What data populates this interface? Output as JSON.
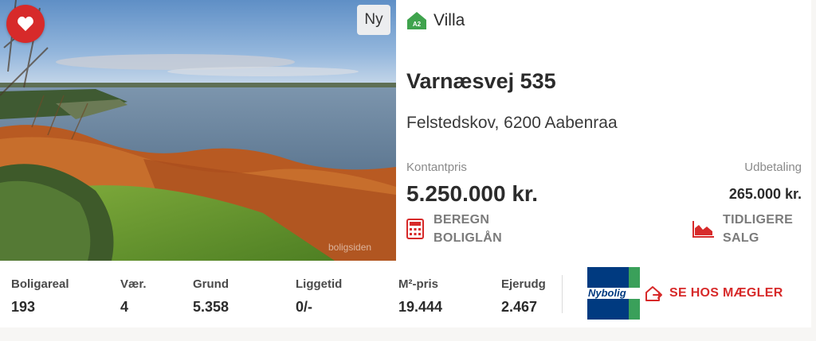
{
  "listing": {
    "badge_new": "Ny",
    "energy_label": "A2",
    "property_type": "Villa",
    "address": "Varnæsvej 535",
    "city": "Felstedskov, 6200 Aabenraa",
    "watermark": "boligsiden",
    "favorite_icon": "heart-icon"
  },
  "price": {
    "label": "Kontantpris",
    "value": "5.250.000 kr."
  },
  "down_payment": {
    "label": "Udbetaling",
    "value": "265.000 kr."
  },
  "actions": {
    "calculate_line1": "BEREGN",
    "calculate_line2": "BOLIGLÅN",
    "previous_sales_line1": "TIDLIGERE",
    "previous_sales_line2": "SALG"
  },
  "stats": [
    {
      "label": "Boligareal",
      "value": "193"
    },
    {
      "label": "Vær.",
      "value": "4"
    },
    {
      "label": "Grund",
      "value": "5.358"
    },
    {
      "label": "Liggetid",
      "value": "0/-"
    },
    {
      "label": "M²-pris",
      "value": "19.444"
    },
    {
      "label": "Ejerudg",
      "value": "2.467"
    }
  ],
  "agent": {
    "logo_text": "Nybolig",
    "cta": "SE HOS MÆGLER"
  },
  "colors": {
    "accent_red": "#d72a2a",
    "energy_green": "#3fa34d",
    "agent_blue": "#003a80"
  }
}
